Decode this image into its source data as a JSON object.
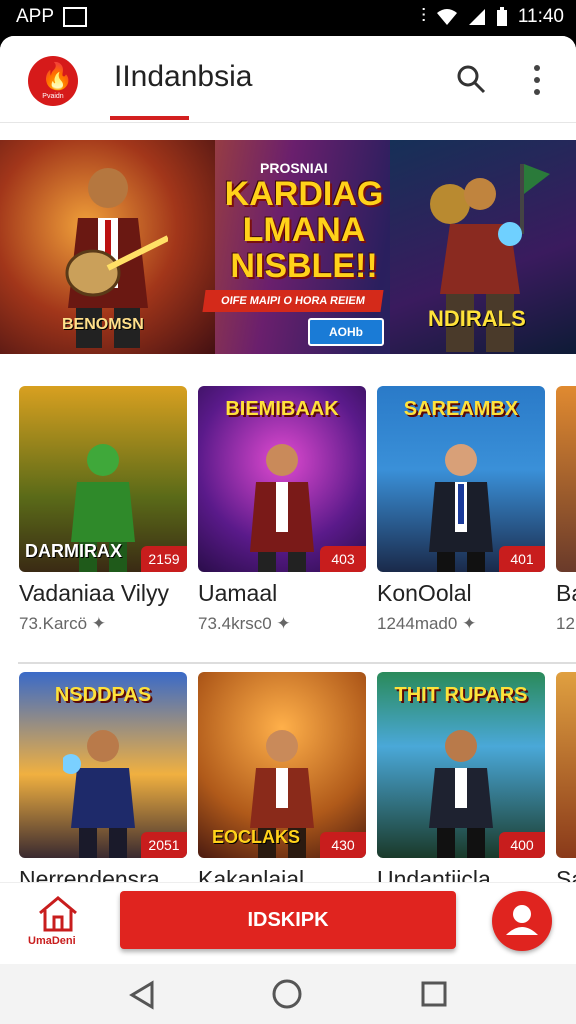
{
  "status_bar": {
    "left_label": "APP",
    "time": "11:40"
  },
  "header": {
    "title": "IIndanbsia",
    "logo_text": "Pvaidn"
  },
  "banner": {
    "small_text": "PROSNIAI",
    "headline": "KARDIAG LMANA NISBLE!!",
    "ribbon": "OIFE MAIPI O HORA REIEM",
    "button": "AOHb",
    "left_name": "BENOMSN",
    "right_name": "NDIRALS"
  },
  "row1": [
    {
      "thumb_title": "",
      "thumb_bottom": "DARMIRAX",
      "badge": "2159",
      "name": "Vadaniaa Vilyy",
      "meta": "73.Karcö"
    },
    {
      "thumb_title": "BIEMIBAAK",
      "thumb_bottom": "",
      "badge": "403",
      "name": "Uamaal",
      "meta": "73.4krsc0"
    },
    {
      "thumb_title": "SAREAMBX",
      "thumb_bottom": "",
      "badge": "401",
      "name": "KonOolal",
      "meta": "1244mad0"
    },
    {
      "thumb_title": "",
      "thumb_bottom": "",
      "badge": "",
      "name": "Ba",
      "meta": "12"
    }
  ],
  "row2": [
    {
      "thumb_title": "NSDDPAS",
      "thumb_bottom": "",
      "badge": "2051",
      "name": "Nerrendensra",
      "meta": ""
    },
    {
      "thumb_title": "",
      "thumb_bottom": "EOCLAKS",
      "badge": "430",
      "name": "Kakanlajal",
      "meta": ""
    },
    {
      "thumb_title": "THIT RUPARS",
      "thumb_bottom": "",
      "badge": "400",
      "name": "Undantiicla",
      "meta": ""
    },
    {
      "thumb_title": "",
      "thumb_bottom": "",
      "badge": "",
      "name": "Sa",
      "meta": ""
    }
  ],
  "bottom_bar": {
    "home_label": "UmaDeni",
    "main_button": "IDSKIPK"
  },
  "colors": {
    "accent": "#e0241f",
    "banner_title": "#ffd21a"
  },
  "icons": [
    "search-icon",
    "more-vert-icon",
    "home-icon",
    "profile-icon",
    "back-icon",
    "home-circle-icon",
    "recents-icon"
  ]
}
